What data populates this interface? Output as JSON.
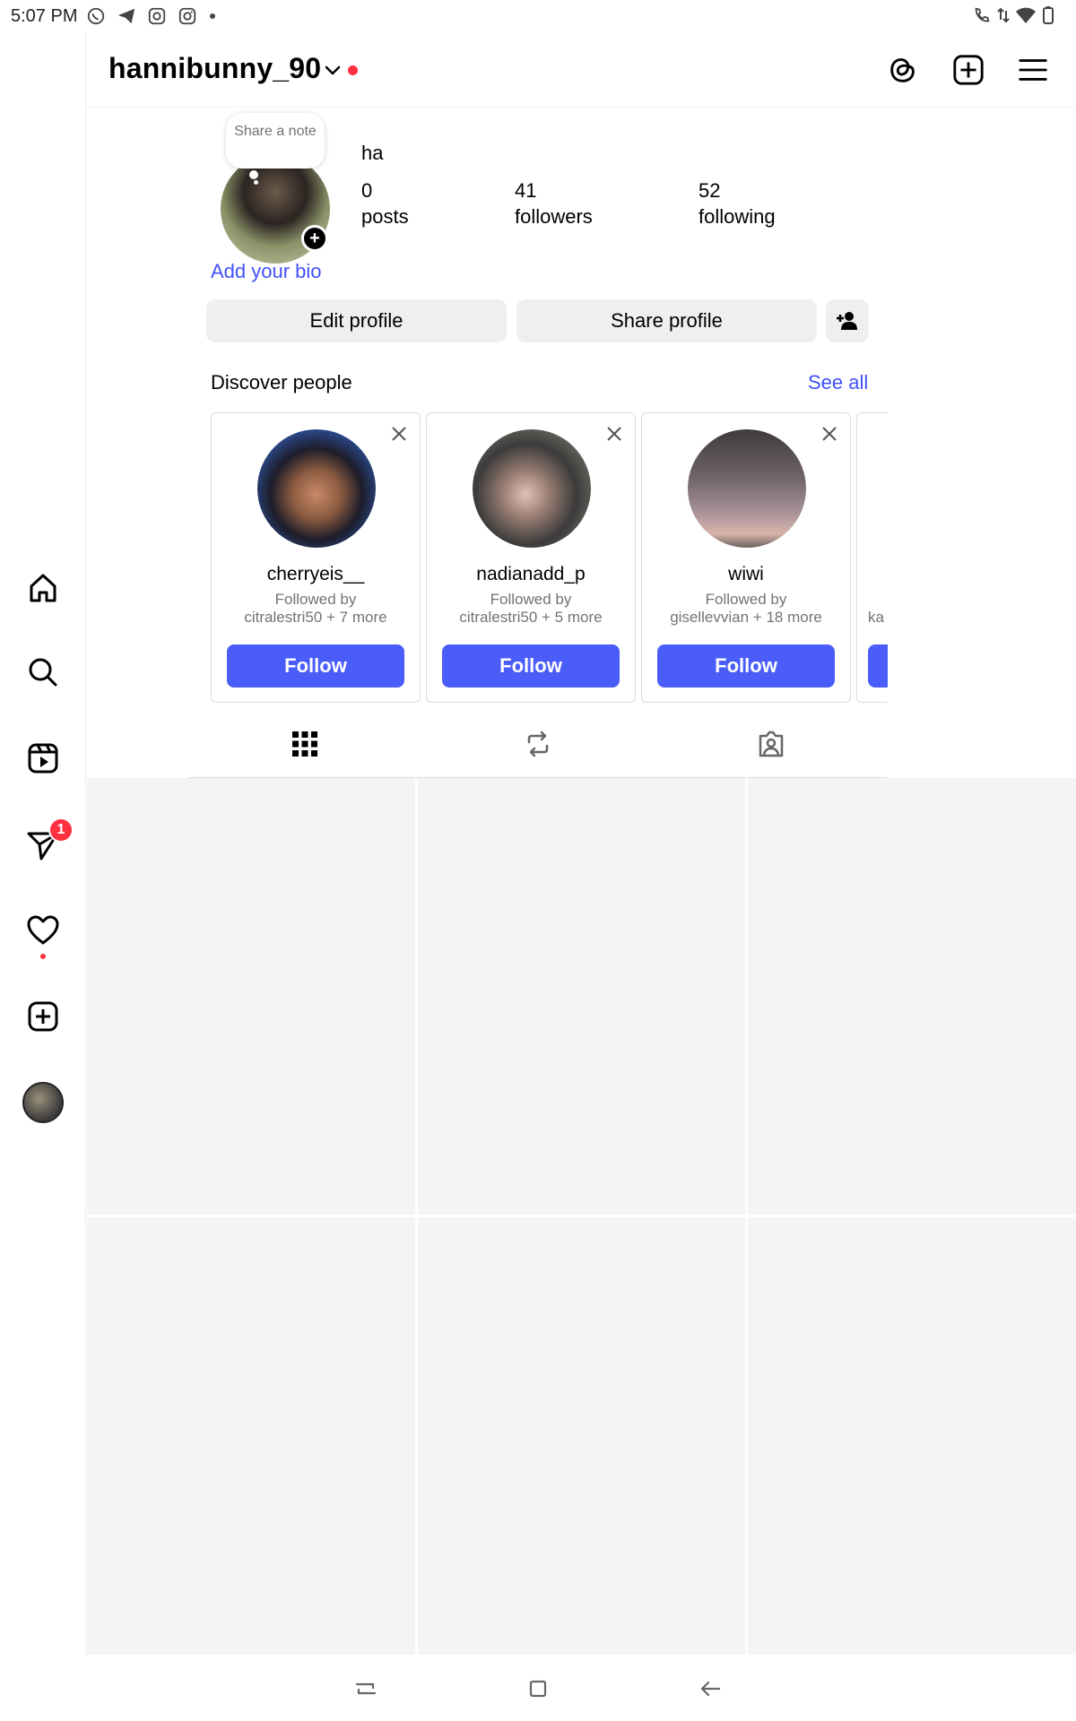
{
  "status_bar": {
    "time": "5:07 PM",
    "left_icons": [
      "whatsapp-icon",
      "telegram-icon",
      "instagram-threads-icon",
      "instagram-icon",
      "dot-icon"
    ],
    "right_icons": [
      "wifi-call-icon",
      "data-arrows-icon",
      "wifi-icon",
      "battery-icon"
    ]
  },
  "header": {
    "username": "hannibunny_90",
    "icons": [
      "threads-icon",
      "create-plus-icon",
      "menu-icon"
    ]
  },
  "side_nav": {
    "items": [
      {
        "name": "home",
        "icon": "home-icon"
      },
      {
        "name": "search",
        "icon": "search-icon"
      },
      {
        "name": "reels",
        "icon": "reels-icon"
      },
      {
        "name": "messages",
        "icon": "direct-message-icon",
        "badge": "1"
      },
      {
        "name": "notifications",
        "icon": "heart-icon"
      },
      {
        "name": "create",
        "icon": "create-plus-icon"
      },
      {
        "name": "profile",
        "icon": "avatar"
      }
    ]
  },
  "profile": {
    "note_prompt": "Share a note",
    "full_name": "ha",
    "stats": [
      {
        "value": "0",
        "label": "posts"
      },
      {
        "value": "41",
        "label": "followers"
      },
      {
        "value": "52",
        "label": "following"
      }
    ],
    "add_bio": "Add your bio",
    "edit_button": "Edit profile",
    "share_button": "Share profile"
  },
  "discover": {
    "title": "Discover people",
    "see_all": "See all",
    "cards": [
      {
        "username": "cherryeis__",
        "followed_by": "Followed by",
        "followed_detail": "citralestri50 + 7 more",
        "follow": "Follow"
      },
      {
        "username": "nadianadd_p",
        "followed_by": "Followed by",
        "followed_detail": "citralestri50 + 5 more",
        "follow": "Follow"
      },
      {
        "username": "wiwi",
        "followed_by": "Followed by",
        "followed_detail": "gisellevvian + 18 more",
        "follow": "Follow"
      }
    ],
    "partial_card_text": "ka"
  },
  "tabs": [
    "grid-icon",
    "reposts-icon",
    "tagged-icon"
  ],
  "colors": {
    "accent": "#4a5df9",
    "link": "#4150f7",
    "badge": "#ff3040",
    "placeholder": "#f3f4f6"
  }
}
